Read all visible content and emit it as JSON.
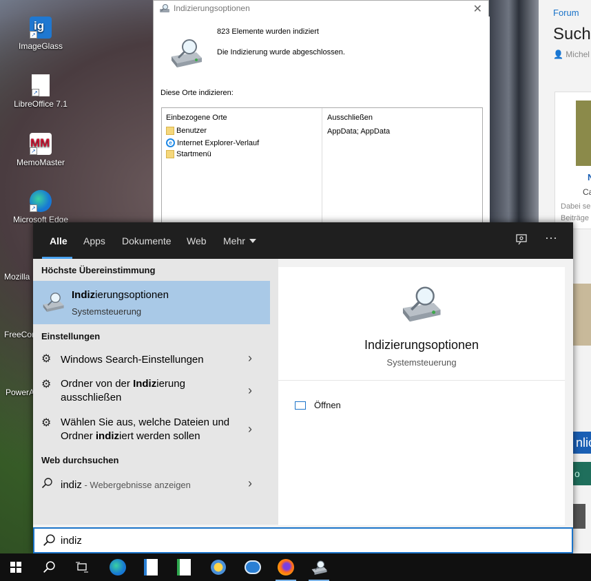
{
  "desktop": {
    "icons": [
      {
        "label": "ImageGlass",
        "icon": "imageglass-icon"
      },
      {
        "label": "LibreOffice 7.1",
        "icon": "libreoffice-icon"
      },
      {
        "label": "MemoMaster",
        "icon": "memomaster-icon"
      },
      {
        "label": "Microsoft Edge",
        "icon": "edge-icon"
      }
    ],
    "partial_labels": [
      "Mozilla",
      "FreeCom",
      "PowerA"
    ]
  },
  "browser": {
    "crumb": "Forum",
    "title": "Suche",
    "author": "Michel",
    "card_title": "N",
    "card_sub": "Ca",
    "card_line1": "Dabei se",
    "card_line2": "Beiträge",
    "blue_button": "nlic",
    "green_button": "o"
  },
  "index_window": {
    "title": "Indizierungsoptionen",
    "close_symbol": "✕",
    "status_count": "823 Elemente wurden indiziert",
    "status_done": "Die Indizierung wurde abgeschlossen.",
    "locations_label": "Diese Orte indizieren:",
    "col_included": "Einbezogene Orte",
    "col_excluded": "Ausschließen",
    "included": [
      "Benutzer",
      "Internet Explorer-Verlauf",
      "Startmenü"
    ],
    "excluded": "AppData; AppData"
  },
  "search": {
    "tabs": [
      "Alle",
      "Apps",
      "Dokumente",
      "Web",
      "Mehr"
    ],
    "active_tab": "Alle",
    "header_icons": [
      "feedback-icon",
      "more-options-icon"
    ],
    "more_dots": "···",
    "best_match_title": "Höchste Übereinstimmung",
    "best_match": {
      "name_bold": "Indiz",
      "name_rest": "ierungsoptionen",
      "sub": "Systemsteuerung"
    },
    "settings_title": "Einstellungen",
    "settings": [
      {
        "pre": "Windows Search-Einstellungen",
        "bold": "",
        "post": ""
      },
      {
        "pre": "Ordner von der ",
        "bold": "Indiz",
        "post": "ierung ausschließen"
      },
      {
        "pre": "Wählen Sie aus, welche Dateien und Ordner ",
        "bold": "indiz",
        "post": "iert werden sollen"
      }
    ],
    "web_title": "Web durchsuchen",
    "web_query": "indiz",
    "web_suffix": " - Webergebnisse anzeigen",
    "detail": {
      "name": "Indizierungsoptionen",
      "sub": "Systemsteuerung",
      "open": "Öffnen"
    },
    "query": "indiz"
  },
  "taskbar": {
    "items": [
      "start-icon",
      "search-icon",
      "task-view-icon",
      "edge-icon",
      "writer-icon",
      "calc-icon",
      "weather-icon",
      "mail-icon",
      "firefox-icon",
      "indexing-icon"
    ]
  },
  "colors": {
    "accent": "#1a73c9",
    "selection": "#a9c9e7",
    "header_bg": "#1f1f1f",
    "taskbar_bg": "#101010"
  }
}
